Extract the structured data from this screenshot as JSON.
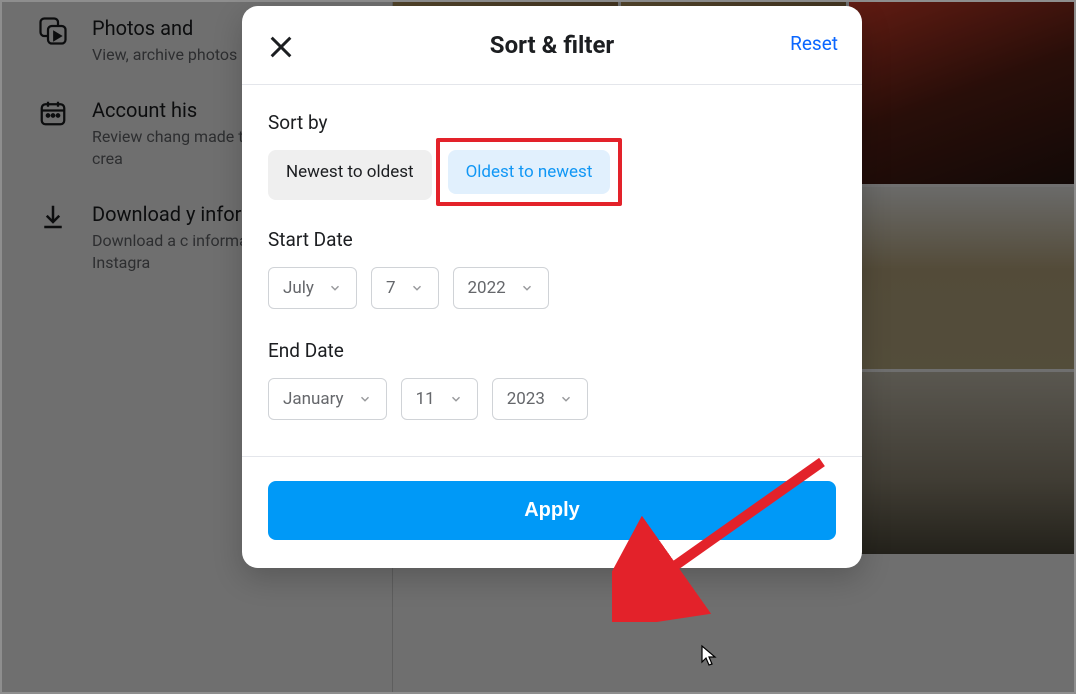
{
  "sidebar": {
    "items": [
      {
        "title": "Photos and",
        "sub": "View, archive photos and v shared."
      },
      {
        "title": "Account his",
        "sub": "Review chang made to your since you crea"
      },
      {
        "title": "Download y information",
        "sub": "Download a c information y with Instagra"
      }
    ]
  },
  "modal": {
    "title": "Sort & filter",
    "reset": "Reset",
    "sort_label": "Sort by",
    "sort_newest": "Newest to oldest",
    "sort_oldest": "Oldest to newest",
    "start_label": "Start Date",
    "start_month": "July",
    "start_day": "7",
    "start_year": "2022",
    "end_label": "End Date",
    "end_month": "January",
    "end_day": "11",
    "end_year": "2023",
    "apply": "Apply"
  }
}
